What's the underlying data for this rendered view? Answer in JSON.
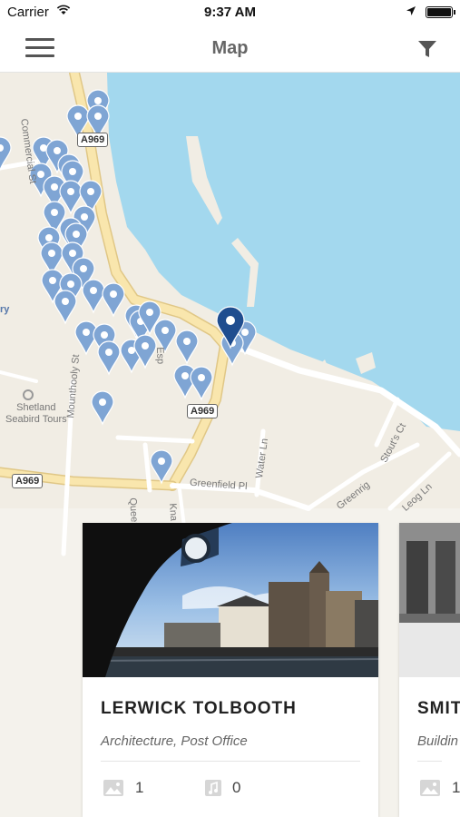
{
  "status_bar": {
    "carrier": "Carrier",
    "time": "9:37 AM"
  },
  "nav": {
    "title": "Map"
  },
  "map": {
    "labels": {
      "place": "Shetland\nSeabird Tours",
      "cut_off": "ry",
      "commercial_st": "Commercial St",
      "mounthooly_st": "Mounthooly St",
      "queens_pl": "Queens Pl",
      "water_ln": "Water Ln",
      "greenfield_pl": "Greenfield Pl",
      "greenrig": "Greenrig",
      "leog_ln": "Leog Ln",
      "stouts_ct": "Stout's Ct",
      "kna": "Kna",
      "esp": "Esp"
    },
    "road_badges": [
      "A969",
      "A969",
      "A969"
    ],
    "colors": {
      "water": "#a3d8ee",
      "land": "#f1ede4",
      "road": "#f9e6ad",
      "pin": "#7fa5d4",
      "pin_selected": "#1f4d8f"
    }
  },
  "cards": [
    {
      "name": "LERWICK TOLBOOTH",
      "category": "Architecture, Post Office",
      "images_count": "1",
      "audio_count": "0",
      "image_icon": "image-icon",
      "audio_icon": "music-note-icon"
    },
    {
      "name": "SMIT",
      "category": "Buildin",
      "images_count": "1",
      "image_icon": "image-icon"
    }
  ]
}
